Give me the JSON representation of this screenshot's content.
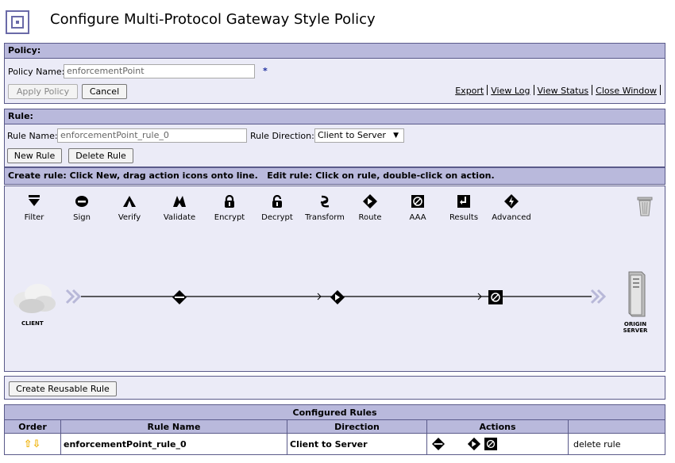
{
  "page": {
    "title": "Configure Multi-Protocol Gateway Style Policy"
  },
  "policy": {
    "header": "Policy:",
    "name_label": "Policy Name:",
    "name_value": "enforcementPoint",
    "required_mark": "*",
    "apply_label": "Apply Policy",
    "cancel_label": "Cancel",
    "links": [
      "Export",
      "View Log",
      "View Status",
      "Close Window"
    ]
  },
  "rule": {
    "header": "Rule:",
    "name_label": "Rule Name:",
    "name_value": "enforcementPoint_rule_0",
    "direction_label": "Rule Direction:",
    "direction_value": "Client to Server",
    "new_label": "New Rule",
    "delete_label": "Delete Rule",
    "instructions": "Create rule: Click New, drag action icons onto line.   Edit rule: Click on rule, double-click on action."
  },
  "palette": [
    {
      "label": "Filter",
      "icon": "filter-icon"
    },
    {
      "label": "Sign",
      "icon": "sign-icon"
    },
    {
      "label": "Verify",
      "icon": "verify-icon"
    },
    {
      "label": "Validate",
      "icon": "validate-icon"
    },
    {
      "label": "Encrypt",
      "icon": "encrypt-icon"
    },
    {
      "label": "Decrypt",
      "icon": "decrypt-icon"
    },
    {
      "label": "Transform",
      "icon": "transform-icon"
    },
    {
      "label": "Route",
      "icon": "route-icon"
    },
    {
      "label": "AAA",
      "icon": "aaa-icon"
    },
    {
      "label": "Results",
      "icon": "results-icon"
    },
    {
      "label": "Advanced",
      "icon": "advanced-icon"
    }
  ],
  "processing_line": {
    "client_label": "CLIENT",
    "server_label_1": "ORIGIN",
    "server_label_2": "SERVER"
  },
  "reusable": {
    "label": "Create Reusable Rule"
  },
  "configured_rules": {
    "caption": "Configured Rules",
    "columns": [
      "Order",
      "Rule Name",
      "Direction",
      "Actions",
      ""
    ],
    "rows": [
      {
        "name": "enforcementPoint_rule_0",
        "direction": "Client to Server",
        "delete": "delete rule"
      }
    ]
  },
  "colors": {
    "panel_header": "#b9b9dc",
    "panel_bg": "#ebebf7",
    "border": "#5a5a8a",
    "order_arrows": "#f0b000"
  }
}
